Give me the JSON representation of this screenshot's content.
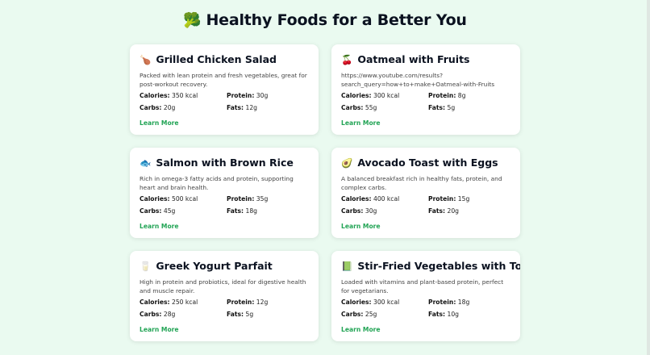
{
  "header": {
    "emoji": "🥦",
    "title": "Healthy Foods for a Better You"
  },
  "labels": {
    "calories": "Calories:",
    "protein": "Protein:",
    "carbs": "Carbs:",
    "fats": "Fats:"
  },
  "cards": [
    {
      "emoji": "🍗",
      "title": "Grilled Chicken Salad",
      "desc": "Packed with lean protein and fresh vegetables, great for post-workout recovery.",
      "calories": "350 kcal",
      "protein": "30g",
      "carbs": "20g",
      "fats": "12g",
      "link": "Learn More"
    },
    {
      "emoji": "🍒",
      "title": "Oatmeal with Fruits",
      "desc": "https://www.youtube.com/results?search_query=how+to+make+Oatmeal-with-Fruits",
      "calories": "300 kcal",
      "protein": "8g",
      "carbs": "55g",
      "fats": "5g",
      "link": "Learn More"
    },
    {
      "emoji": "🐟",
      "title": "Salmon with Brown Rice",
      "desc": "Rich in omega-3 fatty acids and protein, supporting heart and brain health.",
      "calories": "500 kcal",
      "protein": "35g",
      "carbs": "45g",
      "fats": "18g",
      "link": "Learn More"
    },
    {
      "emoji": "🥑",
      "title": "Avocado Toast with Eggs",
      "desc": "A balanced breakfast rich in healthy fats, protein, and complex carbs.",
      "calories": "400 kcal",
      "protein": "15g",
      "carbs": "30g",
      "fats": "20g",
      "link": "Learn More"
    },
    {
      "emoji": "🥛",
      "title": "Greek Yogurt Parfait",
      "desc": "High in protein and probiotics, ideal for digestive health and muscle repair.",
      "calories": "250 kcal",
      "protein": "12g",
      "carbs": "28g",
      "fats": "5g",
      "link": "Learn More"
    },
    {
      "emoji": "📗",
      "title": "Stir-Fried Vegetables with Tofu",
      "desc": "Loaded with vitamins and plant-based protein, perfect for vegetarians.",
      "calories": "300 kcal",
      "protein": "18g",
      "carbs": "25g",
      "fats": "10g",
      "link": "Learn More"
    }
  ]
}
